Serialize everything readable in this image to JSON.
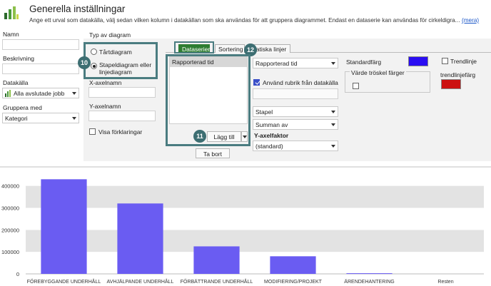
{
  "header": {
    "title": "Generella inställningar",
    "description": "Ange ett urval som datakälla, välj sedan vilken kolumn i datakällan som ska användas för att gruppera diagrammet. Endast en dataserie kan användas för cirkeldigra...",
    "more_link": "(mera)"
  },
  "form": {
    "name_label": "Namn",
    "name_value": "",
    "description_label": "Beskrivning",
    "description_value": "",
    "datasource_label": "Datakälla",
    "datasource_value": "Alla avslutade jobb",
    "group_label": "Gruppera med",
    "group_value": "Kategori"
  },
  "chart_type": {
    "label": "Typ av diagram",
    "pie_label": "Tårtdiagram",
    "bar_label": "Stapeldiagram eller linjediagram",
    "selected": "bar",
    "xaxis_label": "X-axelnamn",
    "xaxis_value": "",
    "yaxis_label": "Y-axelnamn",
    "yaxis_value": "",
    "legend_label": "Visa förklaringar",
    "legend_checked": false
  },
  "tabs": [
    {
      "label": "Dataserier",
      "active": true
    },
    {
      "label": "Sortering",
      "active": false
    },
    {
      "label": "atiska linjer",
      "active": false
    }
  ],
  "series_list": {
    "items": [
      "Rapporterad tid"
    ],
    "add_button": "Lägg till",
    "remove_button": "Ta bort"
  },
  "series_settings": {
    "column_value": "Rapporterad tid",
    "use_header_label": "Använd rubrik från datakälla",
    "use_header_checked": true,
    "use_header_input": "",
    "chart_kind_value": "Stapel",
    "aggregate_value": "Summan av",
    "yaxis_factor_label": "Y-axelfaktor",
    "yaxis_factor_value": "(standard)"
  },
  "colors": {
    "standard_label": "Standardfärg",
    "standard_color": "#2a0df2",
    "trendline_label": "Trendlinje",
    "trendline_checked": false,
    "threshold_label": "Värde tröskel färger",
    "threshold_checked": false,
    "trendline_color_label": "trendlinjefärg",
    "trendline_color": "#cc1111"
  },
  "annotations": {
    "badge_10": "10",
    "badge_11": "11",
    "badge_12": "12"
  },
  "chart_data": {
    "type": "bar",
    "categories": [
      "FÖREBYGGANDE UNDERHÅLL",
      "AVHJÄLPANDE UNDERHÅLL",
      "FÖRBÄTTRANDE UNDERHÅLL",
      "MODIFIERING/PROJEKT",
      "ÄRENDEHANTERING",
      "Resten"
    ],
    "values": [
      430000,
      320000,
      125000,
      80000,
      3000,
      0
    ],
    "ylim": [
      0,
      470000
    ],
    "yticks": [
      0,
      100000,
      200000,
      300000,
      400000
    ],
    "ytick_labels": [
      "0",
      "100000",
      "200000",
      "300000",
      "400000"
    ],
    "bar_color": "#6a5cf2",
    "grid": "alternating-bands",
    "xlabel": "",
    "ylabel": ""
  }
}
